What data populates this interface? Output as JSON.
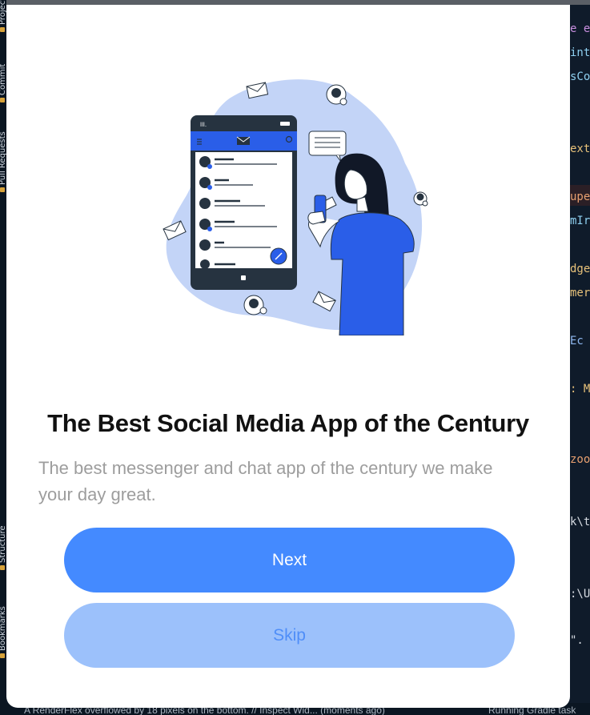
{
  "ide": {
    "side_tabs": [
      "Project",
      "Commit",
      "Pull Requests",
      "Structure",
      "Bookmarks"
    ],
    "code_fragments": [
      "e e",
      "int",
      "sCo",
      "ext",
      "upe",
      "mIr",
      "dge",
      "mer",
      "Ec",
      ": M",
      "zoo",
      "k\\t",
      ":\\U",
      "\"."
    ],
    "status_message": "A RenderFlex overflowed by 18 pixels on the bottom. // Inspect Wid... (moments ago)",
    "status_task": "Running Gradle task"
  },
  "onboarding": {
    "title": "The Best Social Media App of the Century",
    "subtitle": "The best messenger and chat app of the century we make your day great.",
    "next_label": "Next",
    "skip_label": "Skip",
    "illustration": "woman-with-phone-messenger-illustration"
  },
  "colors": {
    "primary": "#448aff",
    "secondary": "#9cc1fb",
    "blob": "#c3d4f7",
    "phone_blue": "#2a5ee8",
    "dark": "#263340"
  }
}
